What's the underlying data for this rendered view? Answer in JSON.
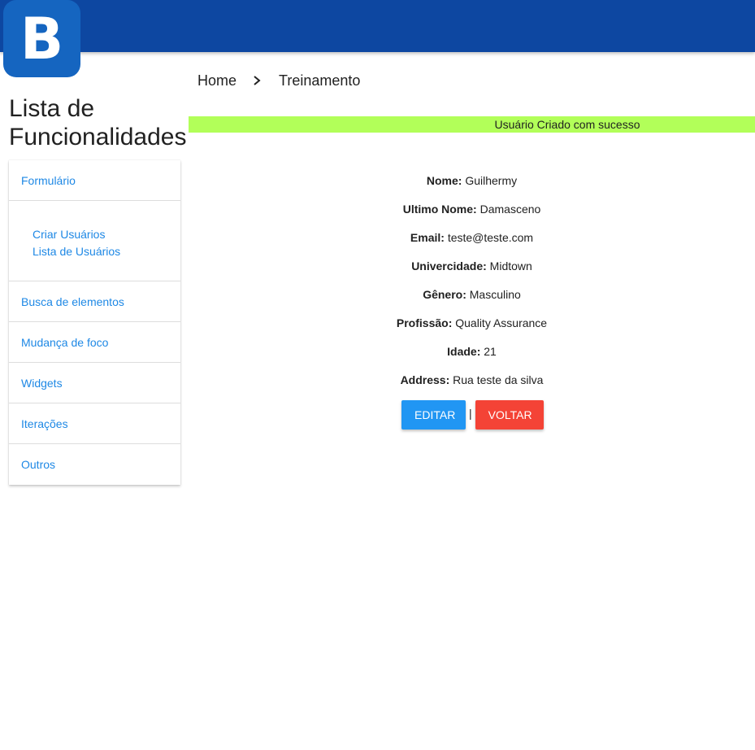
{
  "header": {
    "logo_letter": "B",
    "brand_color": "#0d47a1"
  },
  "breadcrumb": {
    "home": "Home",
    "current": "Treinamento"
  },
  "sidebar": {
    "title": "Lista de Funcionalidades",
    "items": [
      {
        "label": "Formulário"
      },
      {
        "label": "Busca de elementos"
      },
      {
        "label": "Mudança de foco"
      },
      {
        "label": "Widgets"
      },
      {
        "label": "Iterações"
      },
      {
        "label": "Outros"
      }
    ],
    "sub_items": [
      {
        "label": "Criar Usuários"
      },
      {
        "label": "Lista de Usuários"
      }
    ]
  },
  "toast": {
    "message": "Usuário Criado com sucesso",
    "color": "#b2ff59"
  },
  "user": {
    "fields": [
      {
        "label": "Nome:",
        "value": "Guilhermy"
      },
      {
        "label": "Ultimo Nome:",
        "value": "Damasceno"
      },
      {
        "label": "Email:",
        "value": "teste@teste.com"
      },
      {
        "label": "Univercidade:",
        "value": "Midtown"
      },
      {
        "label": "Gênero:",
        "value": "Masculino"
      },
      {
        "label": "Profissão:",
        "value": "Quality Assurance"
      },
      {
        "label": "Idade:",
        "value": "21"
      },
      {
        "label": "Address:",
        "value": "Rua teste da silva"
      }
    ]
  },
  "actions": {
    "edit": "EDITAR",
    "separator": "|",
    "back": "VOLTAR"
  }
}
